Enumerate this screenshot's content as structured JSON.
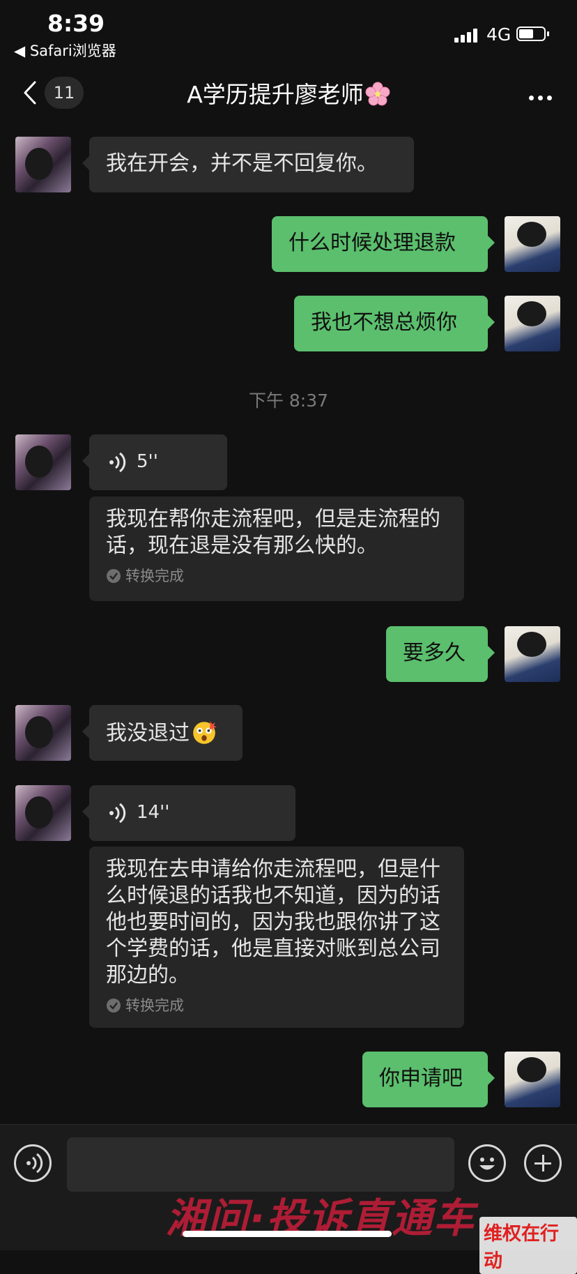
{
  "status_bar": {
    "time": "8:39",
    "back_app": "◀ Safari浏览器",
    "network": "4G"
  },
  "nav": {
    "unread_count": "11",
    "title": "A学历提升廖老师",
    "title_emoji": "cherry-blossom"
  },
  "messages": [
    {
      "from": "teacher",
      "type": "text",
      "text": "我在开会，并不是不回复你。"
    },
    {
      "from": "me",
      "type": "text",
      "text": "什么时候处理退款"
    },
    {
      "from": "me",
      "type": "text",
      "text": "我也不想总烦你"
    },
    {
      "from": "teacher",
      "type": "voice",
      "duration": "5''",
      "transcript": "我现在帮你走流程吧，但是走流程的话，现在退是没有那么快的。",
      "transcript_status": "转换完成"
    },
    {
      "from": "me",
      "type": "text",
      "text": "要多久"
    },
    {
      "from": "teacher",
      "type": "text",
      "text": "我没退过"
    },
    {
      "from": "teacher",
      "type": "voice",
      "duration": "14''",
      "transcript": "我现在去申请给你走流程吧，但是什么时候退的话我也不知道，因为的话他也要时间的，因为我也跟你讲了这个学费的话，他是直接对账到总公司那边的。",
      "transcript_status": "转换完成"
    },
    {
      "from": "me",
      "type": "text",
      "text": "你申请吧"
    }
  ],
  "timestamp": "下午 8:37",
  "watermark": {
    "main": "湘问·投诉直通车",
    "badge": "维权在行动"
  },
  "colors": {
    "background": "#111111",
    "incoming_bubble": "#2c2c2c",
    "outgoing_bubble": "#5bbf6d",
    "watermark_red": "#c81e3a"
  }
}
